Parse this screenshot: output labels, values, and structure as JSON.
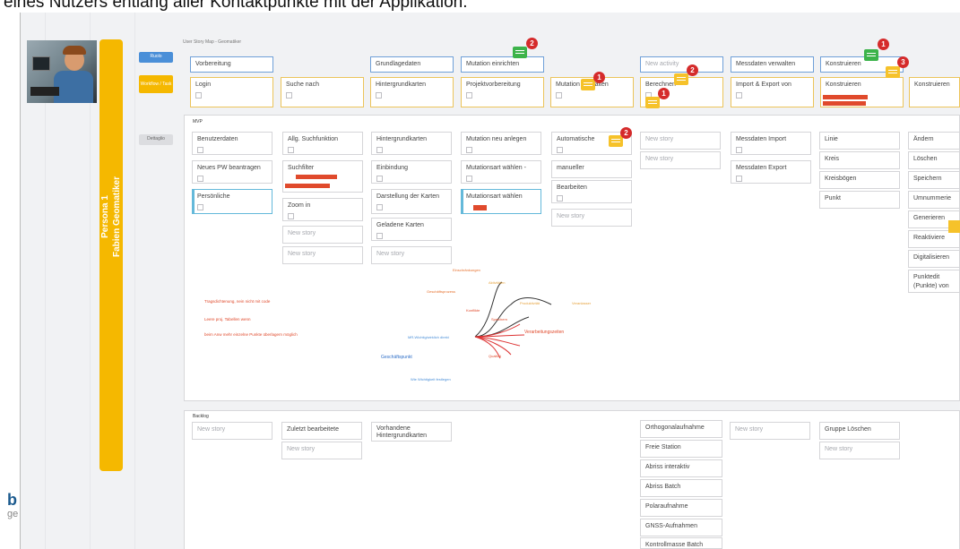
{
  "caption": "eines Nutzers entlang aller Kontaktpunkte mit der Applikation.",
  "board_title": "User Story Map - Geomatiker",
  "persona": {
    "line1": "Persona 1",
    "line2": "Fabien Geomatiker"
  },
  "side_buttons": {
    "blue": "Ruolo",
    "yellow": "Workflow / Task",
    "grey": "Dettaglio"
  },
  "logo": {
    "letter": "b",
    "sub": "ge"
  },
  "release_labels": {
    "first": "MVP",
    "second": "Backlog"
  },
  "activities": [
    "Vorbereitung",
    "Grundlagedaten",
    "Mutation einrichten",
    "New activity",
    "Messdaten verwalten",
    "Konstruieren"
  ],
  "steps": [
    "Login",
    "Suche nach",
    "Hintergrundkarten",
    "Projektvorbereitung",
    "Mutation verwalten",
    "Berechnen",
    "Import & Export von",
    "Konstruieren",
    "Konstruieren"
  ],
  "stories_mvp": {
    "c1": [
      "Benutzerdaten",
      "Neues PW beantragen",
      "Persönliche"
    ],
    "c2": [
      "Allg. Suchfunktion",
      "Suchfilter",
      "Zoom in",
      "New story",
      "New story"
    ],
    "c3": [
      "Hintergrundkarten",
      "Einbindung",
      "Darstellung der Karten",
      "Geladene Karten",
      "New story"
    ],
    "c4": [
      "Mutation neu anlegen",
      "Mutationsart wählen -",
      "Mutationsart wählen"
    ],
    "c5": [
      "Automatische",
      "manueller",
      "Bearbeiten",
      "New story"
    ],
    "c6": [
      "New story",
      "New story"
    ],
    "c7": [
      "Messdaten Import",
      "Messdaten Export"
    ],
    "c8": [
      "Linie",
      "Kreis",
      "Kreisbögen",
      "Punkt"
    ],
    "c9": [
      "Ändern",
      "Löschen",
      "Speichern",
      "Umnummerie",
      "Generieren",
      "Reaktiviere",
      "Digitalisieren",
      "Punktedit (Punkte) von Punktlal"
    ]
  },
  "stories_backlog": {
    "c1": [
      "New story"
    ],
    "c2": [
      "Zuletzt bearbeitete",
      "New story"
    ],
    "c3": [
      "Vorhandene Hintergrundkarten"
    ],
    "c6": [
      "Orthogonalaufnahme",
      "Freie Station",
      "Abriss interaktiv",
      "Abriss Batch",
      "Polaraufnahme",
      "GNSS-Aufnahmen",
      "Kontrollmasse Batch"
    ],
    "c7": [
      "New story"
    ],
    "c8": [
      "Gruppe Löschen",
      "New story"
    ]
  },
  "comment_badges": [
    "2",
    "2",
    "1",
    "2",
    "1",
    "1",
    "3",
    "2"
  ],
  "notes_red": [
    "Tragsdichtenung, nein nicht mit code",
    "Leere proj. Tabellen wenn",
    "beim Anw mehr einzelne Punkte überlagern möglich"
  ],
  "mindmap": {
    "center": "MR-Wichtig/wirklich direkt",
    "branches": [
      "Einschränkungen",
      "Geschäftsprozess",
      "Aktivitäten",
      "Verarbeitungszeiten",
      "Qualität",
      "Konflikte",
      "Speichern",
      "Produktivität",
      "Veranlasser"
    ],
    "blue": [
      "Geschäftspunkt",
      "Wie Wichtigkeit festlegen"
    ]
  },
  "colors": {
    "yellow": "#f5b800",
    "blue": "#4a8fd8",
    "red": "#e04a2c",
    "green": "#3cb34a",
    "badge": "#d52b2b",
    "bubble_yellow": "#f6c22a"
  }
}
